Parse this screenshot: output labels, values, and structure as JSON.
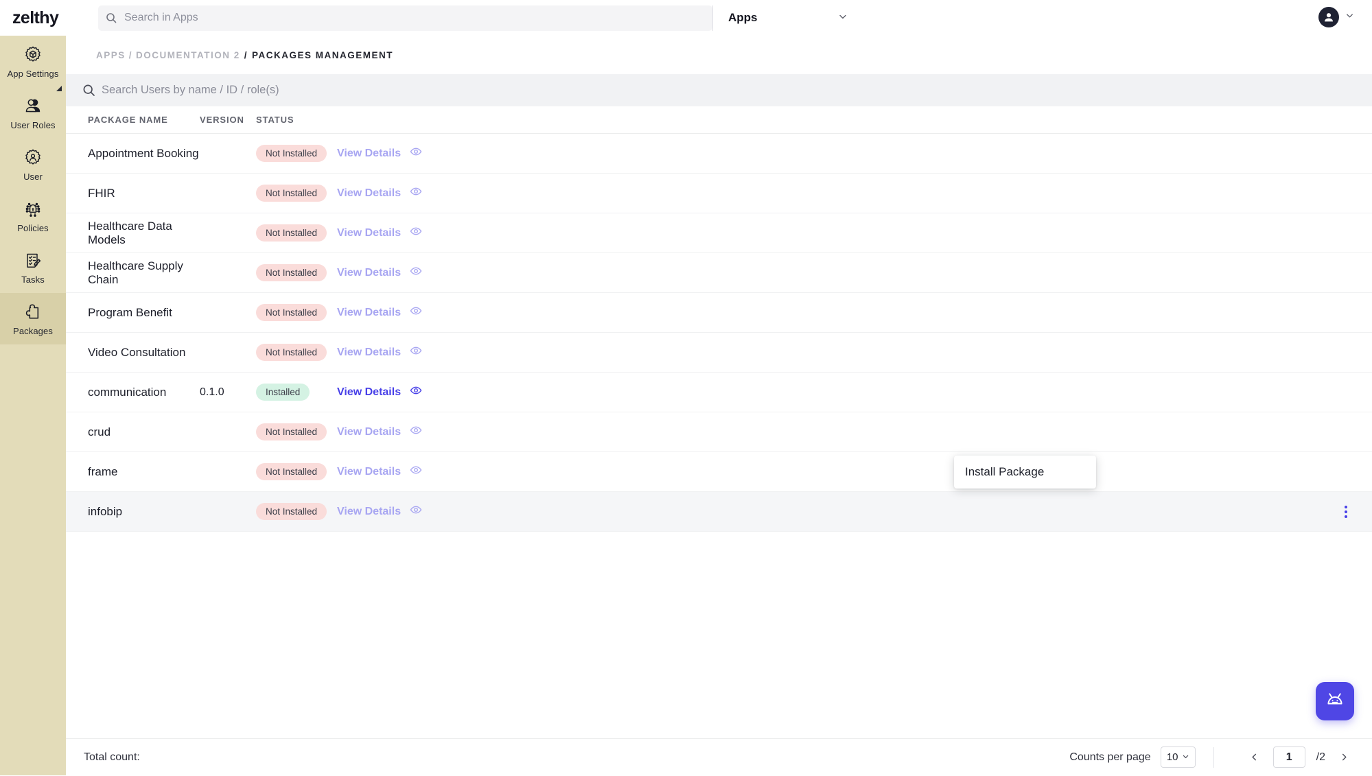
{
  "brand": "zelthy",
  "topbar": {
    "search_placeholder": "Search in Apps",
    "search_value": "",
    "app_selector_label": "Apps",
    "search_icon": "search-icon",
    "chevron_icon": "chevron-down-icon",
    "avatar_icon": "user-avatar-icon"
  },
  "sidebar": {
    "items": [
      {
        "label": "App Settings",
        "icon": "gear-cube-icon",
        "active": false
      },
      {
        "label": "User Roles",
        "icon": "users-icon",
        "active": false
      },
      {
        "label": "User",
        "icon": "gear-user-icon",
        "active": false
      },
      {
        "label": "Policies",
        "icon": "policy-shield-icon",
        "active": false
      },
      {
        "label": "Tasks",
        "icon": "checklist-edit-icon",
        "active": false
      },
      {
        "label": "Packages",
        "icon": "puzzle-piece-icon",
        "active": true
      }
    ]
  },
  "breadcrumb": {
    "root": "APPS",
    "parent": "DOCUMENTATION 2",
    "current": "PACKAGES MANAGEMENT",
    "separator": "/"
  },
  "user_search": {
    "placeholder": "Search Users by name / ID / role(s)",
    "value": "",
    "icon": "search-icon"
  },
  "table": {
    "columns": [
      "PACKAGE NAME",
      "VERSION",
      "STATUS"
    ],
    "action_label": "View Details",
    "action_icon": "eye-icon",
    "rows": [
      {
        "name": "Appointment Booking",
        "version": "",
        "status": "Not Installed",
        "installed": false,
        "highlighted": false
      },
      {
        "name": "FHIR",
        "version": "",
        "status": "Not Installed",
        "installed": false,
        "highlighted": false
      },
      {
        "name": "Healthcare Data Models",
        "version": "",
        "status": "Not Installed",
        "installed": false,
        "highlighted": false
      },
      {
        "name": "Healthcare Supply Chain",
        "version": "",
        "status": "Not Installed",
        "installed": false,
        "highlighted": false
      },
      {
        "name": "Program Benefit",
        "version": "",
        "status": "Not Installed",
        "installed": false,
        "highlighted": false
      },
      {
        "name": "Video Consultation",
        "version": "",
        "status": "Not Installed",
        "installed": false,
        "highlighted": false
      },
      {
        "name": "communication",
        "version": "0.1.0",
        "status": "Installed",
        "installed": true,
        "highlighted": false
      },
      {
        "name": "crud",
        "version": "",
        "status": "Not Installed",
        "installed": false,
        "highlighted": false
      },
      {
        "name": "frame",
        "version": "",
        "status": "Not Installed",
        "installed": false,
        "highlighted": false
      },
      {
        "name": "infobip",
        "version": "",
        "status": "Not Installed",
        "installed": false,
        "highlighted": true
      }
    ]
  },
  "context_menu": {
    "items": [
      "Install Package"
    ],
    "install_label": "Install Package"
  },
  "footer": {
    "total_count_label": "Total count:",
    "total_count_value": "",
    "counts_per_page_label": "Counts per page",
    "counts_per_page_value": "10",
    "prev_icon": "chevron-left-icon",
    "next_icon": "chevron-right-icon",
    "current_page": "1",
    "total_pages": "/2"
  },
  "chat_widget": {
    "icon": "robot-bot-icon"
  },
  "colors": {
    "sidebar_bg": "#e3dcb9",
    "sidebar_active_bg": "#d8d0a8",
    "accent": "#4840e8",
    "accent_dim": "#a8a6f2",
    "badge_not_installed_bg": "#fadcda",
    "badge_installed_bg": "#d4f2e3",
    "chat_bg": "#4f46e5",
    "row_highlight": "#f5f6f8"
  }
}
